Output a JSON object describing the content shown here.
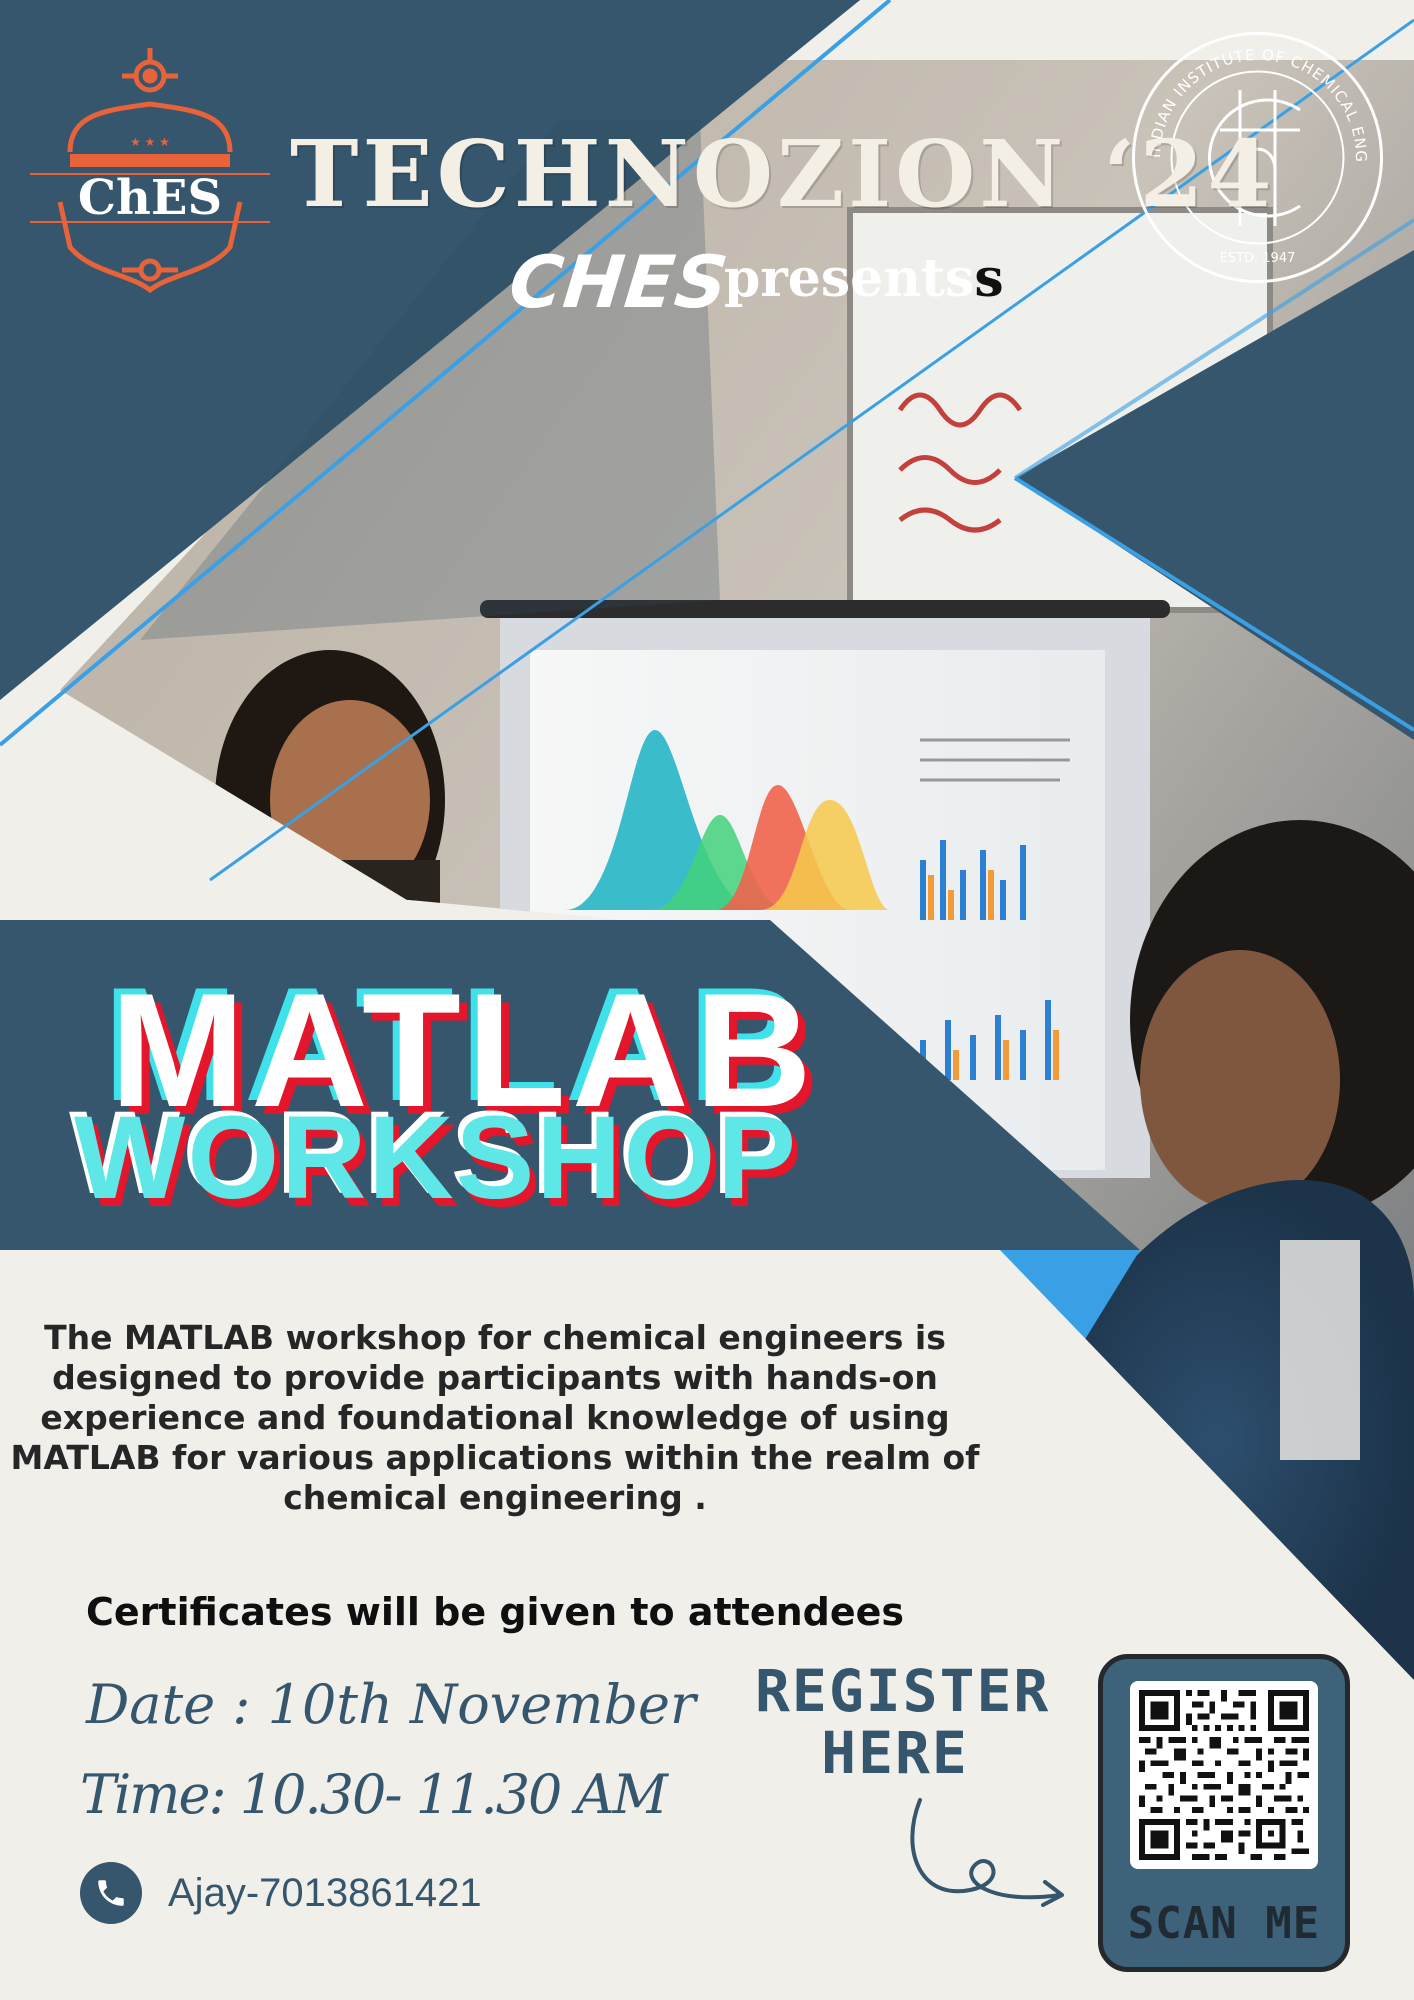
{
  "header": {
    "society_logo_text": "ChES",
    "event_title": "TECHNOZION ‘24",
    "presenter": "CHES",
    "presents_text": "presents",
    "presents_extra_letter": "s",
    "seal": {
      "ring_text": "INDIAN INSTITUTE OF CHEMICAL ENGINEERS",
      "estd": "ESTD. 1947"
    }
  },
  "hero": {
    "title_line1": "MATLAB",
    "title_line2": "WORKSHOP"
  },
  "body": {
    "description": "The MATLAB workshop for chemical engineers is designed to provide participants with hands-on experience and foundational knowledge of using MATLAB for various applications within the realm of chemical engineering .",
    "certificates": "Certificates will be given to attendees",
    "date": "Date : 10th November",
    "time": "Time: 10.30- 11.30 AM",
    "contact": "Ajay-7013861421"
  },
  "register": {
    "label_line1": "REGISTER",
    "label_line2": "HERE",
    "scan_label": "SCAN ME"
  },
  "colors": {
    "navy": "#35566c",
    "cream": "#f1efea",
    "accent_blue": "#3aa0e6",
    "logo_orange": "#e8623a",
    "title_red": "#e3162b",
    "title_cyan": "#3fe1ea"
  },
  "icons": [
    "phone-icon",
    "arrow-curve-icon",
    "qr-code-icon"
  ]
}
